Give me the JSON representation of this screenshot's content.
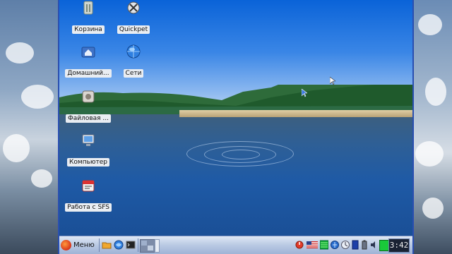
{
  "desktop": {
    "icons": [
      {
        "label": "Корзина",
        "icon": "trash-icon"
      },
      {
        "label": "Quickpet",
        "icon": "quickpet-icon"
      },
      {
        "label": "Домашний...",
        "icon": "home-folder-icon"
      },
      {
        "label": "Сети",
        "icon": "network-globe-icon"
      },
      {
        "label": "Файловая ...",
        "icon": "file-manager-icon"
      },
      {
        "label": "Компьютер",
        "icon": "computer-icon"
      },
      {
        "label": "Работа с SFS",
        "icon": "sfs-package-icon"
      }
    ]
  },
  "taskbar": {
    "menu_label": "Меню",
    "clock": "3:42",
    "colors": {
      "bar": "#b9c9e3",
      "accent": "#2a4fb0"
    }
  }
}
